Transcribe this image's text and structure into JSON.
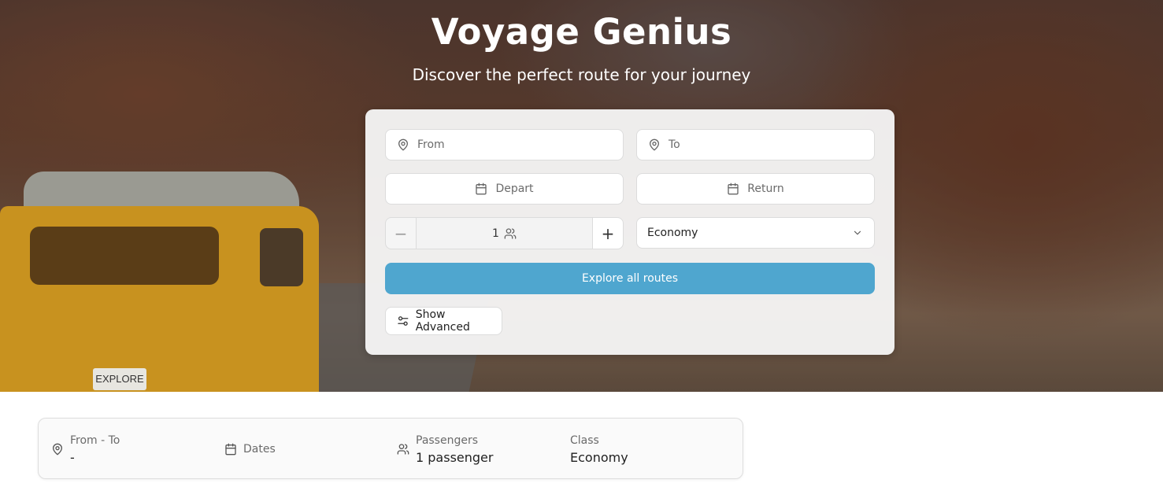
{
  "hero": {
    "title": "Voyage Genius",
    "subtitle": "Discover the perfect route for your journey",
    "van_plate": "EXPLORE"
  },
  "search": {
    "from_placeholder": "From",
    "to_placeholder": "To",
    "depart_placeholder": "Depart",
    "return_placeholder": "Return",
    "passengers_value": "1",
    "minus_symbol": "−",
    "plus_symbol": "+",
    "class_value": "Economy",
    "explore_label": "Explore all routes",
    "advanced_label": "Show Advanced"
  },
  "summary": {
    "route_label": "From - To",
    "route_value": "-",
    "dates_label": "Dates",
    "passengers_label": "Passengers",
    "passengers_value": "1 passenger",
    "class_label": "Class",
    "class_value": "Economy"
  },
  "colors": {
    "accent": "#4fa6cf",
    "card_bg": "#f7f7f7"
  },
  "icons": {
    "location": "map-pin-icon",
    "calendar": "calendar-icon",
    "users": "users-icon",
    "chevron": "chevron-down-icon",
    "sliders": "sliders-icon"
  }
}
